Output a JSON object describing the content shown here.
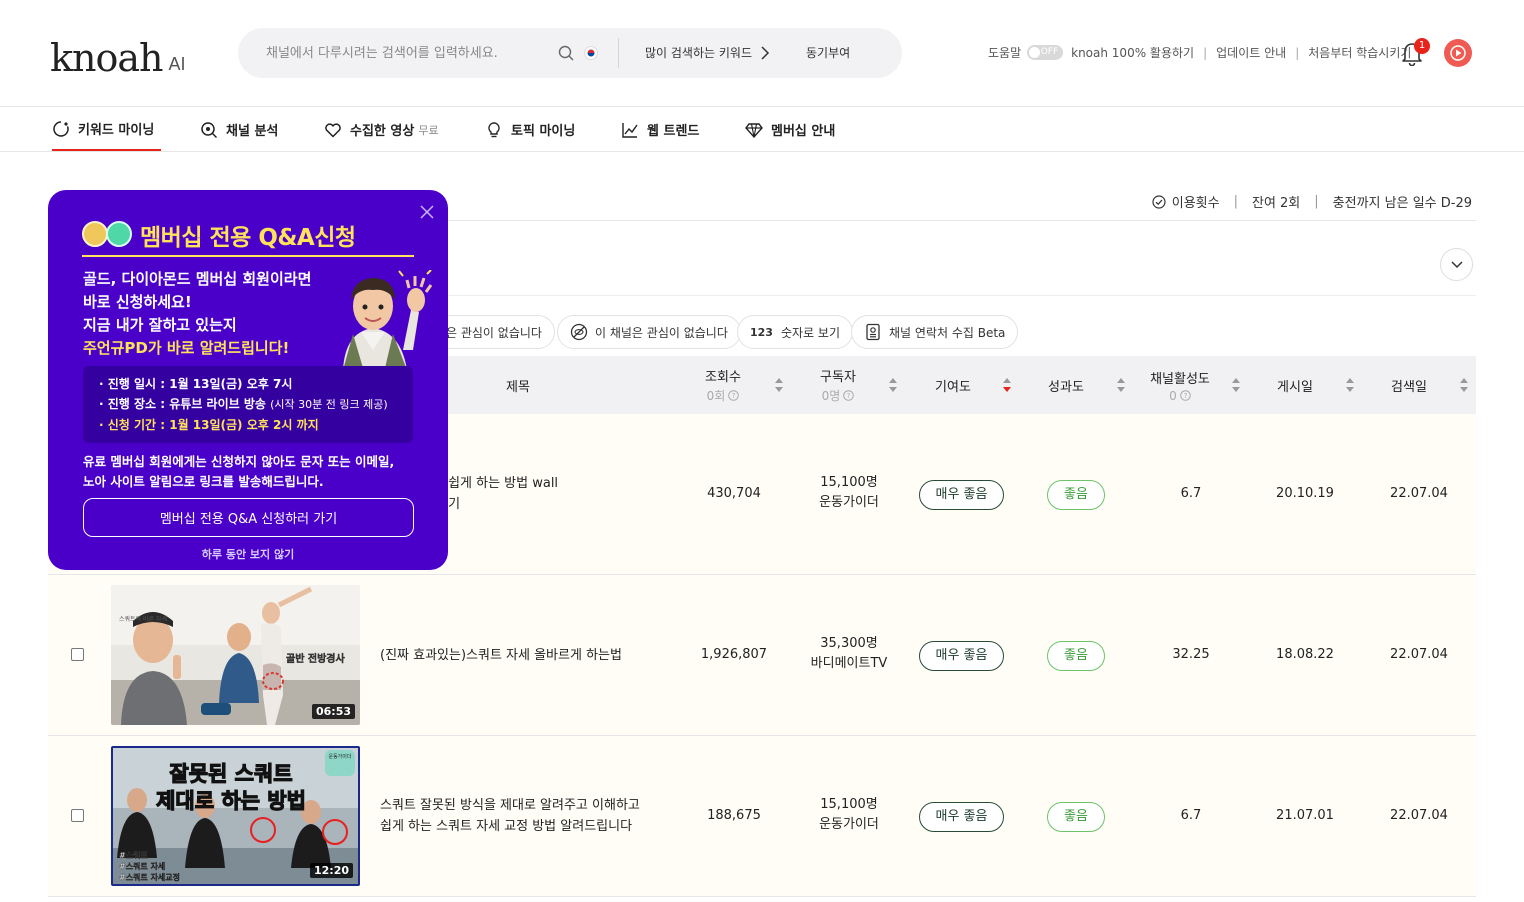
{
  "brand": {
    "logo_text": "knoah",
    "logo_suffix": "AI"
  },
  "search": {
    "placeholder": "채널에서 다루시려는 검색어를 입력하세요.",
    "popular_label": "많이 검색하는 키워드",
    "motive_label": "동기부여"
  },
  "toplinks": {
    "help": "도움말",
    "toggle_state": "OFF",
    "use": "knoah 100% 활용하기",
    "update": "업데이트 안내",
    "learn": "처음부터 학습시키기",
    "notif_count": "1"
  },
  "nav": {
    "keyword": "키워드 마이닝",
    "channel": "채널 분석",
    "collected": "수집한 영상",
    "collected_free": "무료",
    "topic": "토픽 마이닝",
    "web": "웹 트렌드",
    "membership": "멤버십 안내"
  },
  "usage": {
    "label": "이용횟수",
    "remaining": "잔여 2회",
    "days": "충전까지 남은 일수 D-29"
  },
  "filters": {
    "f1": "은 관심이 없습니다",
    "f2": "이 채널은 관심이 없습니다",
    "f3_num": "123",
    "f3": "숫자로 보기",
    "f4": "채널 연락처 수집 Beta"
  },
  "columns": {
    "title": "제목",
    "views": "조회수",
    "views_sub": "0회",
    "subs": "구독자",
    "subs_sub": "0명",
    "contrib": "기여도",
    "perf": "성과도",
    "activity": "채널활성도",
    "activity_sub": "0",
    "posted": "게시일",
    "searched": "검색일"
  },
  "rows": [
    {
      "title": "리되지 않고 쉽게 하는 방법 wall 고 스쿼트 하기",
      "title_l1": "리되지 않고 쉽게 하는 방법 wall",
      "title_l2": "고 스쿼트 하기",
      "views": "430,704",
      "subs": "15,100명",
      "channel": "운동가이더",
      "contrib": "매우 좋음",
      "perf": "좋음",
      "activity": "6.7",
      "posted": "20.10.19",
      "searched": "22.07.04"
    },
    {
      "title": "(진짜 효과있는)스쿼트 자세 올바르게 하는법",
      "views": "1,926,807",
      "subs": "35,300명",
      "channel": "바디메이트TV",
      "contrib": "매우 좋음",
      "perf": "좋음",
      "activity": "32.25",
      "posted": "18.08.22",
      "searched": "22.07.04",
      "duration": "06:53",
      "thumb_caption": "골반 전방경사",
      "thumb_sub": "스쿼트의 바른 자세"
    },
    {
      "title_l1": "스쿼트 잘못된 방식을 제대로 알려주고 이해하고",
      "title_l2": "쉽게 하는 스쿼트 자세 교정 방법 알려드립니다",
      "views": "188,675",
      "subs": "15,100명",
      "channel": "운동가이더",
      "contrib": "매우 좋음",
      "perf": "좋음",
      "activity": "6.7",
      "posted": "21.07.01",
      "searched": "22.07.04",
      "duration": "12:20",
      "thumb_line1": "잘못된 스쿼트",
      "thumb_line2": "제대로 하는 방법",
      "thumb_tags": [
        "#스쿼트",
        "#스쿼트 자세",
        "#스쿼트 자세교정"
      ],
      "thumb_corner": "운동가이더"
    }
  ],
  "popup": {
    "title": "멤버십 전용 Q&A신청",
    "lead1": "골드, 다이아몬드 멤버십 회원이라면",
    "lead2": "바로 신청하세요!",
    "lead3": "지금 내가 잘하고 있는지",
    "lead4": "주언규PD가 바로 알려드립니다!",
    "info1": "· 진행 일시 : 1월 13일(금) 오후 7시",
    "info2": "· 진행 장소 : 유튜브 라이브 방송",
    "info2_small": "(시작 30분 전 링크 제공)",
    "info3": "· 신청 기간 : 1월 13일(금) 오후 2시 까지",
    "desc1": "유료 멤버십 회원에게는 신청하지 않아도 문자 또는 이메일,",
    "desc2": "노아 사이트 알림으로 링크를 발송해드립니다.",
    "button": "멤버십 전용 Q&A 신청하러 가기",
    "dismiss": "하루 동안 보지 않기"
  },
  "colors": {
    "accent": "#e8231c",
    "popup_bg": "#4a00c8",
    "popup_highlight": "#ffe25a",
    "good_green": "#6cc36a"
  }
}
